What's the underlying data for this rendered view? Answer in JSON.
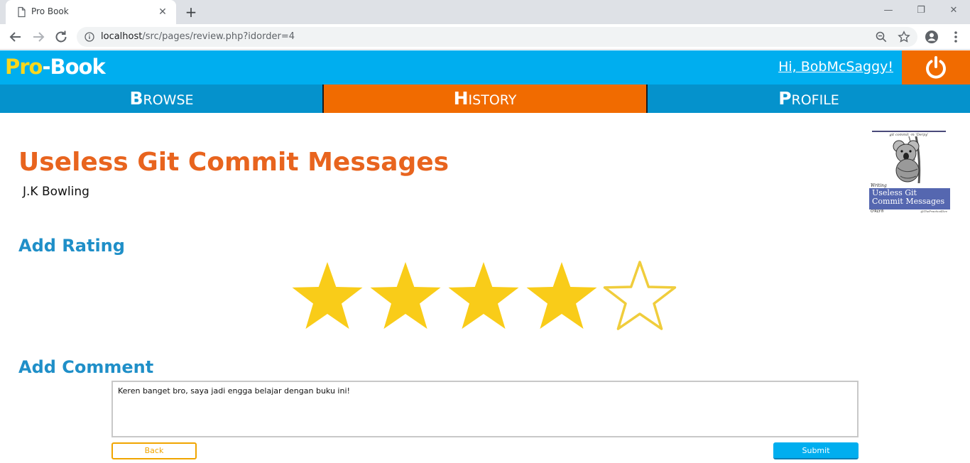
{
  "browser": {
    "tab_title": "Pro Book",
    "url_host": "localhost",
    "url_path": "/src/pages/review.php?idorder=4"
  },
  "header": {
    "logo_pro": "Pro",
    "logo_dash": "-",
    "logo_book": "Book",
    "greeting": "Hi, BobMcSaggy!"
  },
  "nav": {
    "browse_initial": "B",
    "browse_rest": "ROWSE",
    "history_initial": "H",
    "history_rest": "ISTORY",
    "profile_initial": "P",
    "profile_rest": "ROFILE",
    "active": "history"
  },
  "book": {
    "title": "Useless Git Commit Messages",
    "author": "J.K Bowling",
    "cover": {
      "tagline": "git commit -m 'Derpy'",
      "writing": "Writing",
      "band_line1": "Useless Git",
      "band_line2": "Commit Messages",
      "publisher": "O'RLY®",
      "author": "@ThePracticalDev"
    }
  },
  "rating": {
    "heading": "Add Rating",
    "value": 4,
    "max": 5,
    "filled_color": "#f9cc19",
    "empty_stroke_color": "#f0cd3c"
  },
  "comment": {
    "heading": "Add Comment",
    "text": "Keren banget bro, saya jadi engga belajar dengan buku ini!"
  },
  "buttons": {
    "back": "Back",
    "submit": "Submit"
  },
  "colors": {
    "header_bg": "#00aeef",
    "nav_bg": "#0592cc",
    "accent_orange": "#f16b00",
    "title_orange": "#e8641e",
    "heading_blue": "#1f8fc8"
  }
}
